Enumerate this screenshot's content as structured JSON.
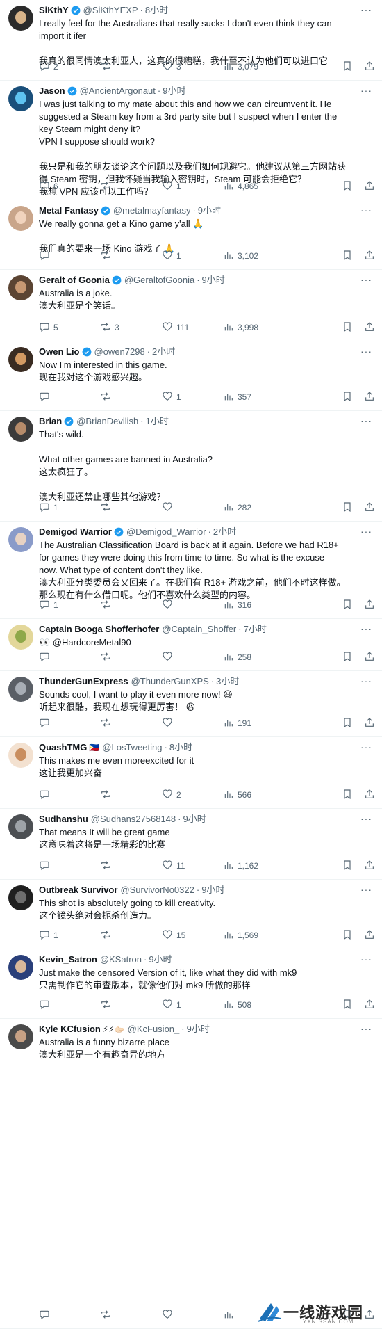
{
  "tweets": [
    {
      "name": "SiKthY",
      "verified": true,
      "handle": "@SiKthYEXP",
      "time": "8小时",
      "lines": [
        "I really feel for the Australians that really sucks I don't even think they can",
        "import it ifer",
        "",
        "我真的很同情澳大利亚人，这真的很糟糕，我什至不认为他们可以进口它"
      ],
      "replies": "2",
      "retweets": "",
      "likes": "3",
      "views": "3,079",
      "avatar_bg": "#2b2b2b",
      "face": "#d8b48a"
    },
    {
      "name": "Jason",
      "verified": true,
      "handle": "@AncientArgonaut",
      "time": "9小时",
      "lines": [
        "I was just talking to my mate about this and how we can circumvent it. He",
        "suggested a Steam key from a 3rd party site but I suspect when I enter the",
        "key Steam might deny it?",
        "VPN I suppose should work?",
        "",
        "我只是和我的朋友谈论这个问题以及我们如何规避它。他建议从第三方网站获",
        "得 Steam 密钥，但我怀疑当我输入密钥时，Steam 可能会拒绝它？",
        "我想 VPN 应该可以工作吗？"
      ],
      "replies": "6",
      "retweets": "",
      "likes": "1",
      "views": "4,865",
      "avatar_bg": "#1a4f7a",
      "face": "#5fc3f0"
    },
    {
      "name": "Metal Fantasy",
      "verified": true,
      "handle": "@metalmayfantasy",
      "time": "9小时",
      "lines": [
        "We really gonna get a Kino game y'all 🙏",
        "",
        "我们真的要来一场 Kino 游戏了 🙏"
      ],
      "replies": "",
      "retweets": "",
      "likes": "1",
      "views": "3,102",
      "avatar_bg": "#c9a58a",
      "face": "#f1d3bd"
    },
    {
      "name": "Geralt of Goonia",
      "verified": true,
      "handle": "@GeraltofGoonia",
      "time": "9小时",
      "lines": [
        "Australia is a joke.",
        "澳大利亚是个笑话。"
      ],
      "replies": "5",
      "retweets": "3",
      "likes": "111",
      "views": "3,998",
      "avatar_bg": "#5b4433",
      "face": "#c79873"
    },
    {
      "name": "Owen Lio",
      "verified": true,
      "handle": "@owen7298",
      "time": "2小时",
      "lines": [
        "Now I'm interested in this game.",
        "现在我对这个游戏感兴趣。"
      ],
      "replies": "",
      "retweets": "",
      "likes": "1",
      "views": "357",
      "avatar_bg": "#3a2c22",
      "face": "#d39a63"
    },
    {
      "name": "Brian",
      "verified": true,
      "handle": "@BrianDevilish",
      "time": "1小时",
      "lines": [
        "That's wild.",
        "",
        "What other games are banned in Australia?",
        "这太疯狂了。",
        "",
        "澳大利亚还禁止哪些其他游戏？"
      ],
      "replies": "1",
      "retweets": "",
      "likes": "",
      "views": "282",
      "avatar_bg": "#3b3b3b",
      "face": "#b58b6a"
    },
    {
      "name": "Demigod Warrior",
      "verified": true,
      "handle": "@Demigod_Warrior",
      "time": "2小时",
      "lines": [
        "The Australian Classification Board is back at it again. Before we had R18+",
        "for games they were doing this from time to time. So what is the excuse",
        "now. What type of content don't they like.",
        "澳大利亚分类委员会又回来了。在我们有 R18+ 游戏之前，他们不时这样做。",
        "那么现在有什么借口呢。他们不喜欢什么类型的内容。"
      ],
      "replies": "1",
      "retweets": "",
      "likes": "",
      "views": "316",
      "avatar_bg": "#8a9bc9",
      "face": "#e7d2c3"
    },
    {
      "name": "Captain Booga Shofferhofer",
      "verified": false,
      "handle": "@Captain_Shoffer",
      "time": "7小时",
      "lines": [
        "👀 @HardcoreMetal90"
      ],
      "replies": "",
      "retweets": "",
      "likes": "",
      "views": "258",
      "avatar_bg": "#e3d79a",
      "face": "#8fa84a"
    },
    {
      "name": "ThunderGunExpress",
      "verified": false,
      "handle": "@ThunderGunXPS",
      "time": "3小时",
      "lines": [
        "Sounds cool, I want to play it even more now! 😆",
        "听起来很酷，我现在想玩得更厉害！ 😆"
      ],
      "replies": "",
      "retweets": "",
      "likes": "",
      "views": "191",
      "avatar_bg": "#5a5f66",
      "face": "#a7adb5"
    },
    {
      "name": "QuashTMG",
      "verified": false,
      "flag": "🇵🇭",
      "handle": "@LosTweeting",
      "time": "8小时",
      "lines": [
        "This makes me even moreexcited for it",
        "这让我更加兴奋"
      ],
      "replies": "",
      "retweets": "",
      "likes": "2",
      "views": "566",
      "avatar_bg": "#f3e1d0",
      "face": "#c98e5f"
    },
    {
      "name": "Sudhanshu",
      "verified": false,
      "handle": "@Sudhans27568148",
      "time": "9小时",
      "lines": [
        "That means It will be great game",
        "这意味着这将是一场精彩的比赛"
      ],
      "replies": "",
      "retweets": "",
      "likes": "11",
      "views": "1,162",
      "avatar_bg": "#4c4f53",
      "face": "#9ea3a8"
    },
    {
      "name": "Outbreak Survivor",
      "verified": false,
      "handle": "@SurvivorNo0322",
      "time": "9小时",
      "lines": [
        "This shot is absolutely going to kill creativity.",
        "这个镜头绝对会扼杀创造力。"
      ],
      "replies": "1",
      "retweets": "",
      "likes": "15",
      "views": "1,569",
      "avatar_bg": "#1f1f1f",
      "face": "#6d6d6d"
    },
    {
      "name": "Kevin_Satron",
      "verified": false,
      "handle": "@KSatron",
      "time": "9小时",
      "lines": [
        "Just make the censored Version of it, like what they did with mk9",
        "只需制作它的审查版本，就像他们对 mk9 所做的那样"
      ],
      "replies": "",
      "retweets": "",
      "likes": "1",
      "views": "508",
      "avatar_bg": "#2a3f7a",
      "face": "#d8b79a"
    },
    {
      "name": "Kyle KCfusion",
      "verified": false,
      "emojis": "⚡⚡🫱🏻",
      "handle": "@KcFusion_",
      "time": "9小时",
      "lines": [
        "Australia is a funny bizarre place",
        "澳大利亚是一个有趣奇异的地方"
      ],
      "replies": "",
      "retweets": "",
      "likes": "",
      "views": "",
      "avatar_bg": "#4a4a4a",
      "face": "#c7a184"
    }
  ],
  "watermark": {
    "title": "一线游戏园",
    "url": "YXNISSAN.COM"
  },
  "colors": {
    "text": "#0f1419",
    "secondary": "#536471",
    "verified": "#1d9bf0",
    "divider": "#eff3f4"
  }
}
